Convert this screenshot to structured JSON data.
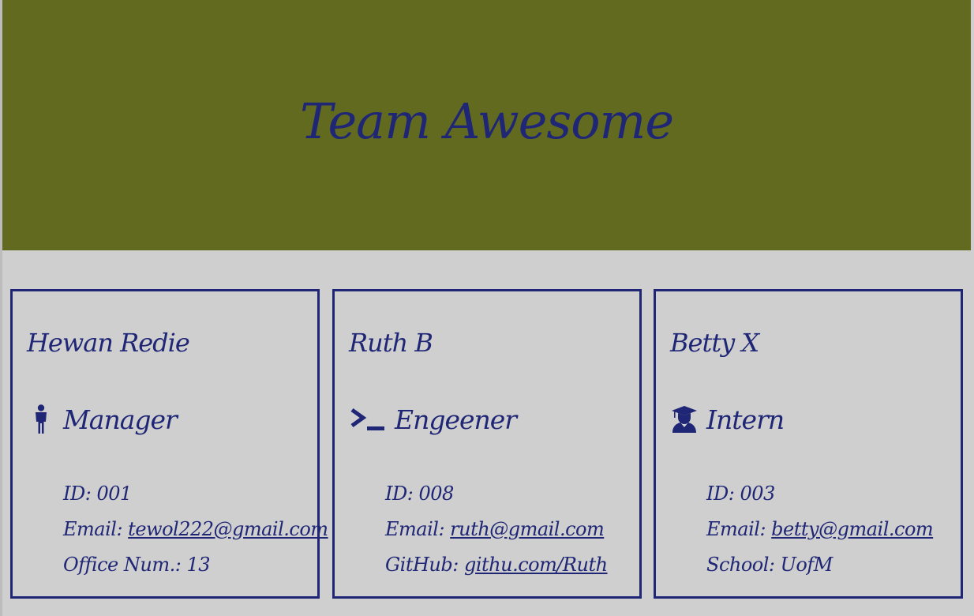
{
  "header": {
    "title": "Team Awesome"
  },
  "cards": [
    {
      "name": "Hewan Redie",
      "role": "Manager",
      "role_icon": "person-icon",
      "id_label": "ID:",
      "id": "001",
      "email_label": "Email:",
      "email": "tewol222@gmail.com",
      "extra_label": "Office Num.:",
      "extra_value": "13"
    },
    {
      "name": "Ruth B",
      "role": "Engeener",
      "role_icon": "terminal-icon",
      "id_label": "ID:",
      "id": "008",
      "email_label": "Email:",
      "email": "ruth@gmail.com",
      "extra_label": "GitHub:",
      "extra_value": "githu.com/Ruth"
    },
    {
      "name": "Betty X",
      "role": "Intern",
      "role_icon": "graduate-icon",
      "id_label": "ID:",
      "id": "003",
      "email_label": "Email:",
      "email": "betty@gmail.com",
      "extra_label": "School:",
      "extra_value": "UofM"
    }
  ],
  "colors": {
    "header_bg": "#626a1f",
    "text": "#1f2675",
    "page_bg": "#cfcfcf"
  }
}
